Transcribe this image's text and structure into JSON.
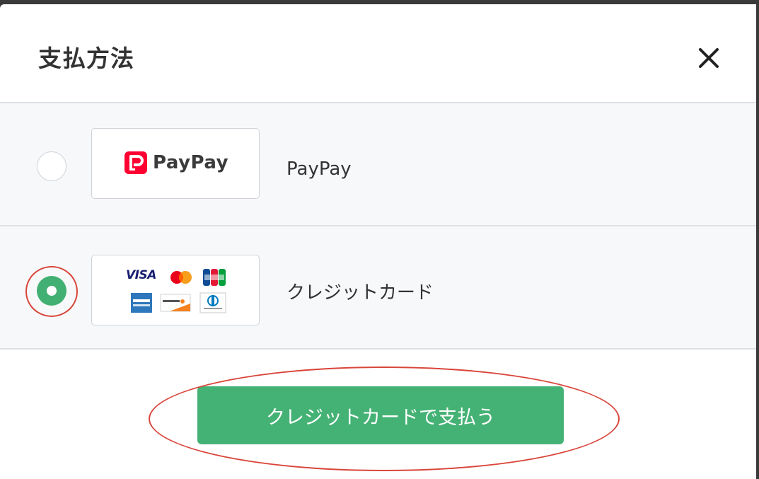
{
  "modal": {
    "title": "支払方法",
    "close_icon": "close-icon"
  },
  "options": [
    {
      "id": "paypay",
      "label": "PayPay",
      "logo_text": "PayPay",
      "selected": false
    },
    {
      "id": "credit-card",
      "label": "クレジットカード",
      "logo_text": "VISA",
      "card_brands": [
        "VISA",
        "Mastercard",
        "JCB",
        "American Express",
        "Discover",
        "Diners Club"
      ],
      "selected": true
    }
  ],
  "pay_button": {
    "label": "クレジットカードで支払う"
  },
  "colors": {
    "accent_green": "#45b275",
    "annotation_red": "#d9453a",
    "paypay_red": "#ff0033"
  }
}
